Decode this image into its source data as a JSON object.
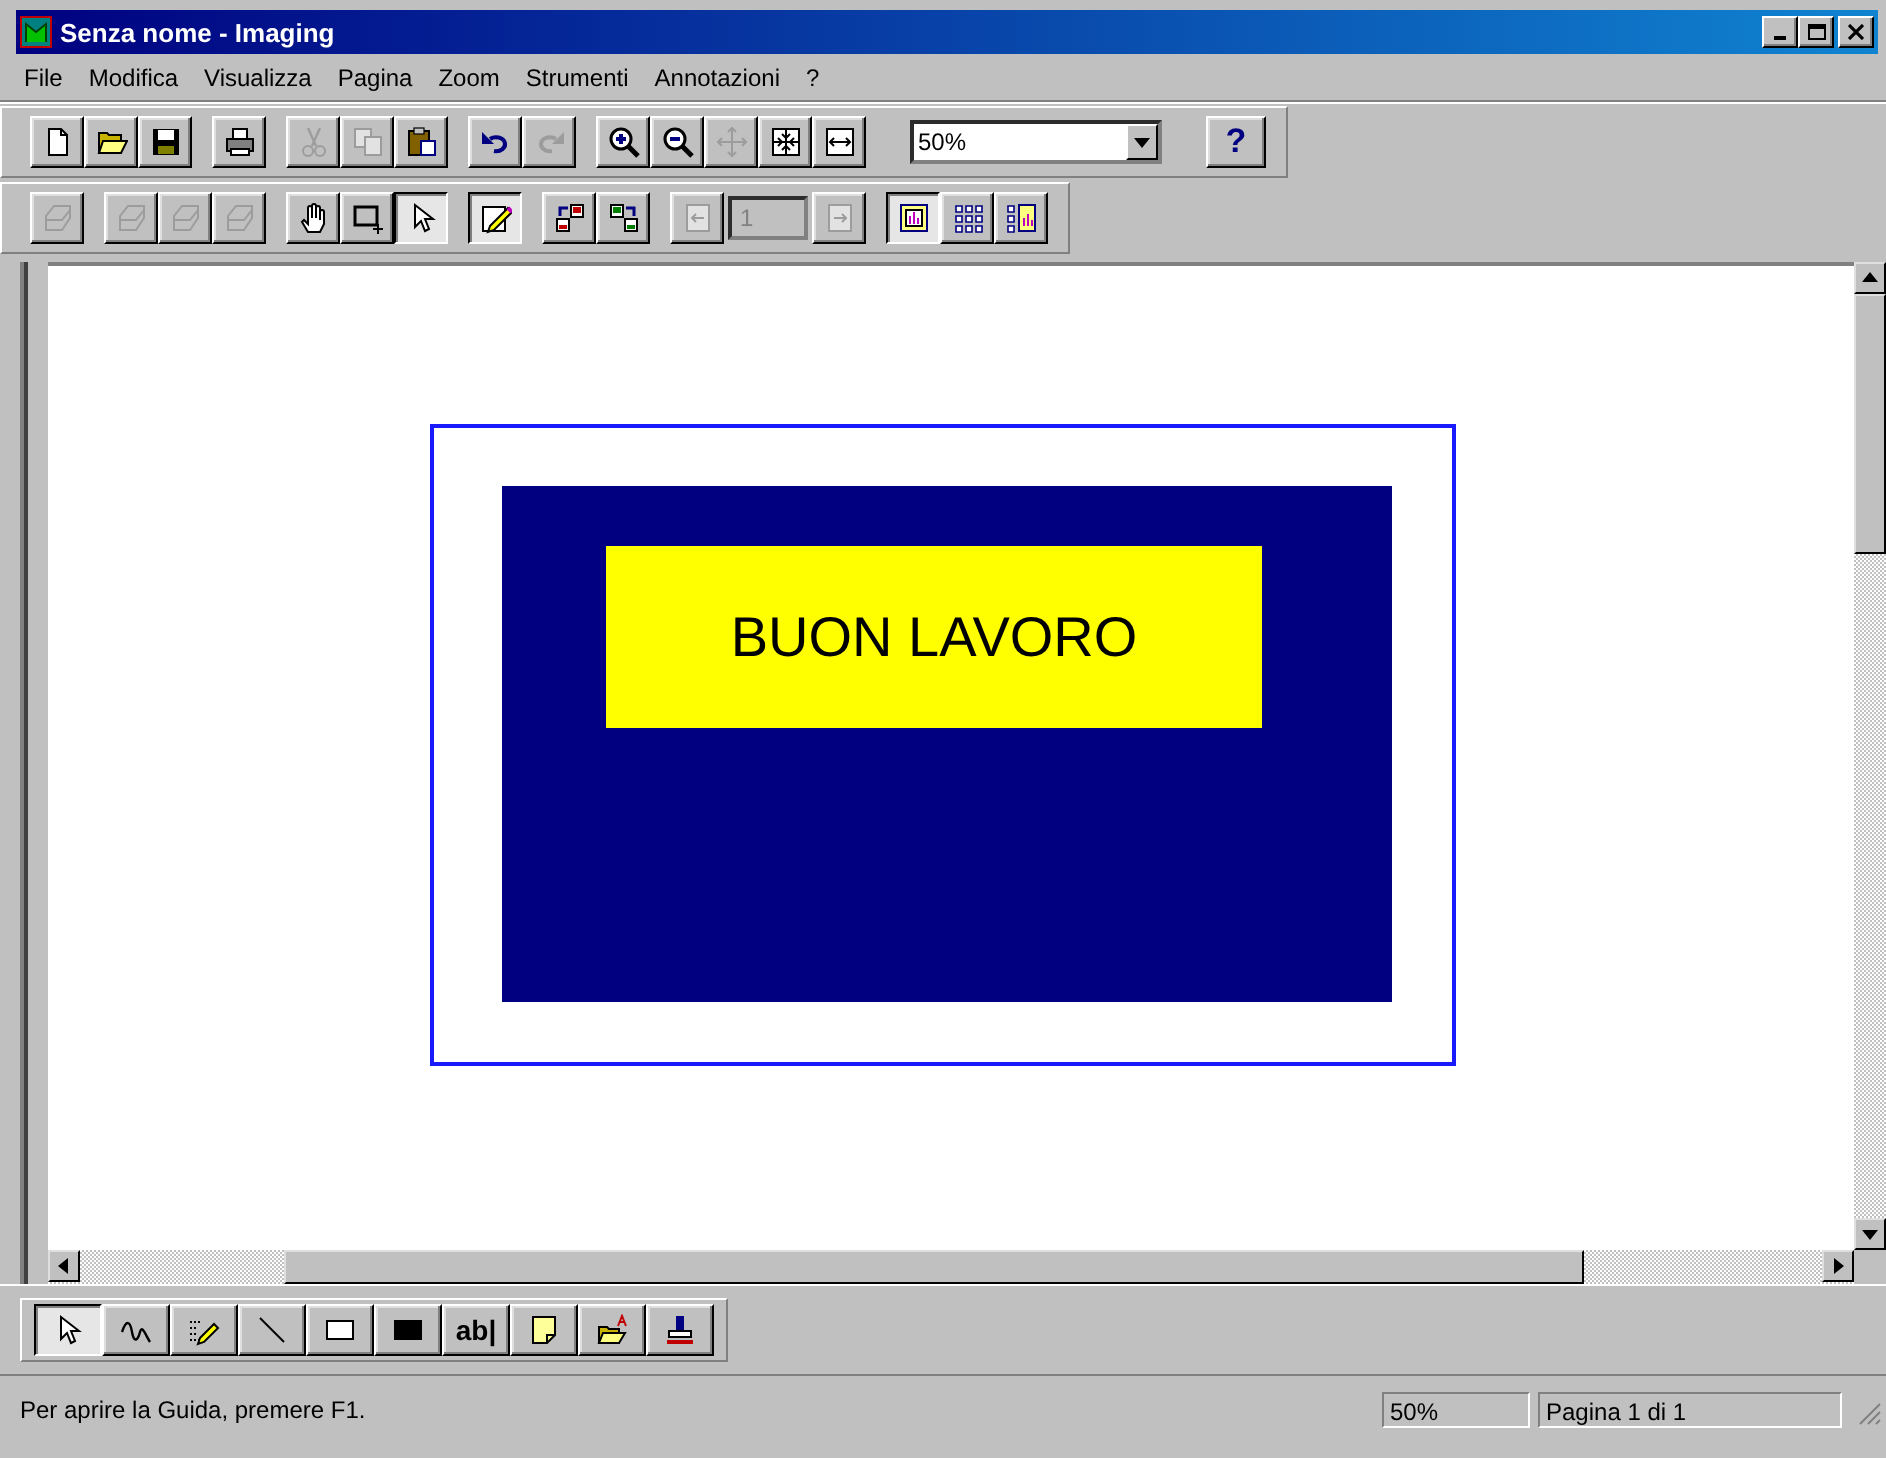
{
  "window": {
    "title": "Senza nome - Imaging"
  },
  "menu": [
    {
      "label": "File"
    },
    {
      "label": "Modifica"
    },
    {
      "label": "Visualizza"
    },
    {
      "label": "Pagina"
    },
    {
      "label": "Zoom"
    },
    {
      "label": "Strumenti"
    },
    {
      "label": "Annotazioni"
    },
    {
      "label": "?"
    }
  ],
  "toolbars": [
    {
      "groups": [
        [
          {
            "kind": "new",
            "disabled": false,
            "pressed": false
          },
          {
            "kind": "open",
            "disabled": false,
            "pressed": false
          },
          {
            "kind": "save",
            "disabled": false,
            "pressed": false
          }
        ],
        [
          {
            "kind": "print",
            "disabled": false,
            "pressed": false
          }
        ],
        [
          {
            "kind": "cut",
            "disabled": true,
            "pressed": false
          },
          {
            "kind": "copy",
            "disabled": true,
            "pressed": false
          },
          {
            "kind": "paste",
            "disabled": false,
            "pressed": false
          }
        ],
        [
          {
            "kind": "undo",
            "disabled": false,
            "pressed": false
          },
          {
            "kind": "redo",
            "disabled": true,
            "pressed": false
          }
        ],
        [
          {
            "kind": "zoom-in",
            "disabled": false,
            "pressed": false
          },
          {
            "kind": "zoom-out",
            "disabled": false,
            "pressed": false
          },
          {
            "kind": "drag",
            "disabled": true,
            "pressed": false
          },
          {
            "kind": "fit",
            "disabled": false,
            "pressed": false
          },
          {
            "kind": "fit-width",
            "disabled": false,
            "pressed": false
          }
        ],
        [
          {
            "kind": "combo",
            "value": "50%"
          }
        ],
        [
          {
            "kind": "help",
            "label": "?",
            "disabled": false,
            "pressed": false
          }
        ]
      ]
    },
    {
      "groups": [
        [
          {
            "kind": "scan",
            "disabled": true,
            "pressed": false
          }
        ],
        [
          {
            "kind": "scan",
            "disabled": true,
            "pressed": false
          },
          {
            "kind": "scan",
            "disabled": true,
            "pressed": false
          },
          {
            "kind": "scan",
            "disabled": true,
            "pressed": false
          }
        ],
        [
          {
            "kind": "hand",
            "disabled": false,
            "pressed": false
          },
          {
            "kind": "rect-select",
            "disabled": false,
            "pressed": false
          },
          {
            "kind": "pointer",
            "disabled": false,
            "pressed": true
          }
        ],
        [
          {
            "kind": "annotation",
            "disabled": false,
            "pressed": true
          }
        ],
        [
          {
            "kind": "rotate-left",
            "disabled": false,
            "pressed": false
          },
          {
            "kind": "rotate-right",
            "disabled": false,
            "pressed": false
          }
        ],
        [
          {
            "kind": "prev-page",
            "disabled": true,
            "pressed": false
          },
          {
            "kind": "field",
            "value": "1",
            "disabled": true
          },
          {
            "kind": "next-page",
            "disabled": true,
            "pressed": false
          }
        ],
        [
          {
            "kind": "one-page",
            "disabled": false,
            "pressed": true
          },
          {
            "kind": "thumbnails",
            "disabled": false,
            "pressed": false
          },
          {
            "kind": "page-thumbs",
            "disabled": false,
            "pressed": false
          }
        ]
      ]
    }
  ],
  "document": {
    "banner": "BUON LAVORO"
  },
  "annotation_toolbar": {
    "buttons": [
      {
        "kind": "pointer",
        "disabled": false,
        "pressed": true
      },
      {
        "kind": "freehand",
        "disabled": false,
        "pressed": false
      },
      {
        "kind": "highlighter",
        "disabled": false,
        "pressed": false
      },
      {
        "kind": "line",
        "disabled": false,
        "pressed": false
      },
      {
        "kind": "hollow-rect",
        "disabled": false,
        "pressed": false
      },
      {
        "kind": "filled-rect",
        "disabled": false,
        "pressed": false
      },
      {
        "kind": "text",
        "label": "ab|",
        "disabled": false,
        "pressed": false
      },
      {
        "kind": "note",
        "disabled": false,
        "pressed": false
      },
      {
        "kind": "text-file",
        "disabled": false,
        "pressed": false
      },
      {
        "kind": "stamp",
        "disabled": false,
        "pressed": false
      }
    ]
  },
  "status_bar": {
    "message": "Per aprire la Guida, premere F1.",
    "zoom": "50%",
    "page": "Pagina 1 di 1"
  }
}
